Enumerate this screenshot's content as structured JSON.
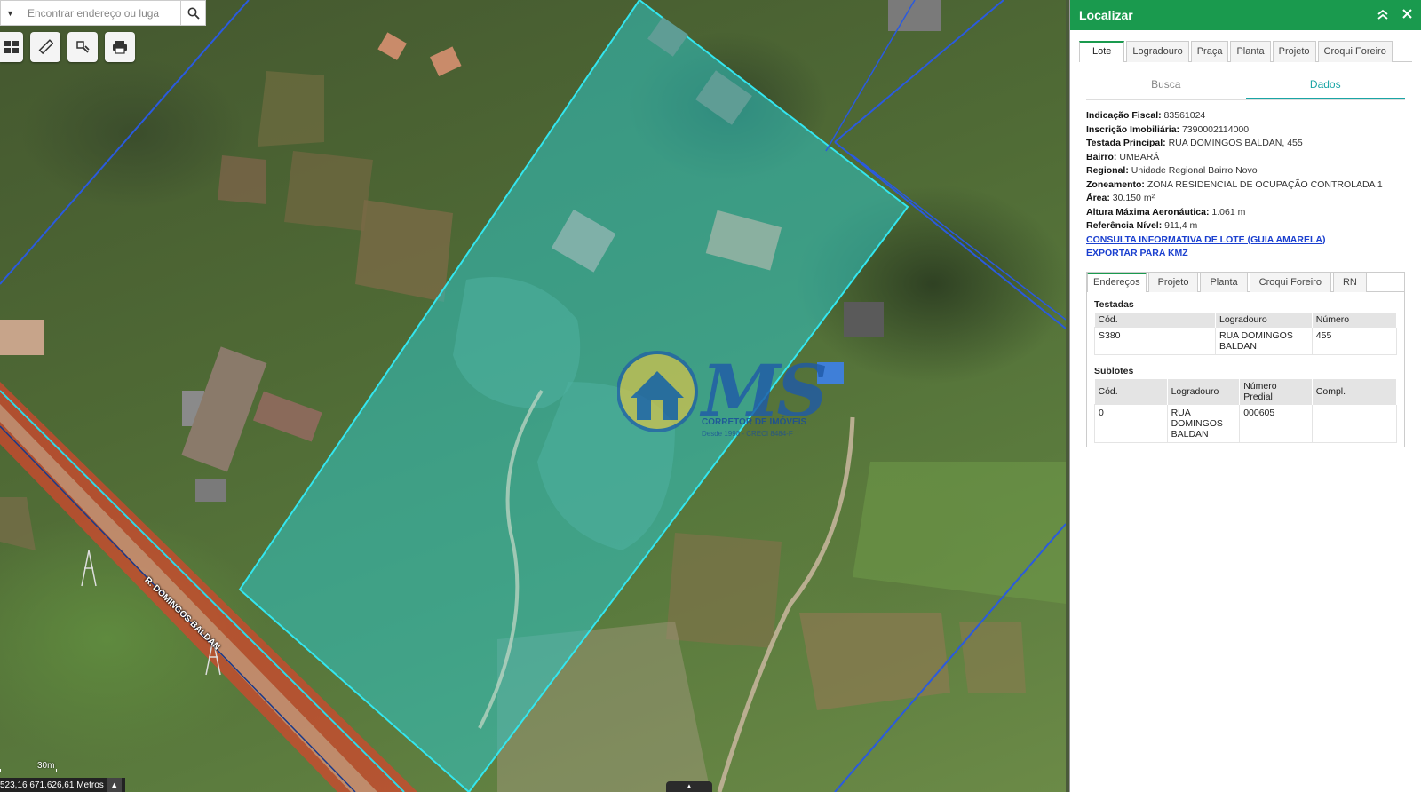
{
  "search": {
    "placeholder": "Encontrar endereço ou luga"
  },
  "map": {
    "road_label": "R. DOMINGOS BALDAN",
    "scale_label": "30m",
    "coords_text": "523,16 671.626,61 Metros",
    "logo_text": "MS",
    "logo_sub": "CORRETOR DE IMÓVEIS",
    "logo_sub2": "Desde 1998 - CRECI 8484-F"
  },
  "panel": {
    "title": "Localizar",
    "tabs": [
      "Lote",
      "Logradouro",
      "Praça",
      "Planta",
      "Projeto",
      "Croqui Foreiro"
    ],
    "subtabs": [
      "Busca",
      "Dados"
    ],
    "info": [
      {
        "label": "Indicação Fiscal:",
        "value": "83561024"
      },
      {
        "label": "Inscrição Imobiliária:",
        "value": "7390002114000"
      },
      {
        "label": "Testada Principal:",
        "value": "RUA DOMINGOS BALDAN, 455"
      },
      {
        "label": "Bairro:",
        "value": "UMBARÁ"
      },
      {
        "label": "Regional:",
        "value": "Unidade Regional Bairro Novo"
      },
      {
        "label": "Zoneamento:",
        "value": "ZONA RESIDENCIAL DE OCUPAÇÃO CONTROLADA 1"
      },
      {
        "label": "Área:",
        "value": "30.150 m²"
      },
      {
        "label": "Altura Máxima Aeronáutica:",
        "value": "1.061 m"
      },
      {
        "label": "Referência Nível:",
        "value": "911,4 m"
      }
    ],
    "links": [
      "CONSULTA INFORMATIVA DE LOTE (GUIA AMARELA)",
      "EXPORTAR PARA KMZ"
    ],
    "lower_tabs": [
      "Endereços",
      "Projeto",
      "Planta",
      "Croqui Foreiro",
      "RN"
    ],
    "testadas": {
      "title": "Testadas",
      "headers": [
        "Cód.",
        "Logradouro",
        "Número"
      ],
      "rows": [
        [
          "S380",
          "RUA DOMINGOS BALDAN",
          "455"
        ]
      ]
    },
    "sublotes": {
      "title": "Sublotes",
      "headers": [
        "Cód.",
        "Logradouro",
        "Número Predial",
        "Compl."
      ],
      "rows": [
        [
          "0",
          "RUA DOMINGOS BALDAN",
          "000605",
          ""
        ]
      ]
    }
  },
  "colors": {
    "header_green": "#1a9a4e",
    "parcel_fill": "#2ec4c4",
    "link_blue": "#1a3fcf"
  }
}
